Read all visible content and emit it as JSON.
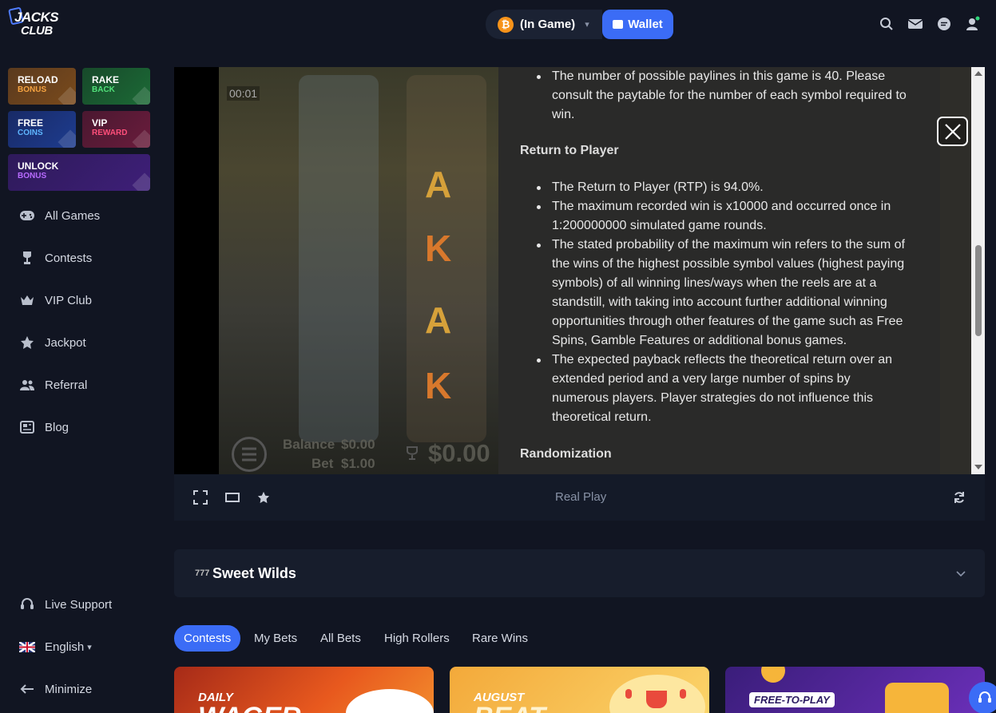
{
  "brand": {
    "line1": "JACKS",
    "line2": "CLUB"
  },
  "header": {
    "balance_label": "(In Game)",
    "currency_symbol": "₿",
    "wallet_label": "Wallet"
  },
  "promos": [
    {
      "title": "RELOAD",
      "sub": "BONUS",
      "color": "#f6a341"
    },
    {
      "title": "RAKE",
      "sub": "BACK",
      "color": "#52e27a"
    },
    {
      "title": "FREE",
      "sub": "COINS",
      "color": "#5fb6ff"
    },
    {
      "title": "VIP",
      "sub": "REWARD",
      "color": "#ff4f7a"
    },
    {
      "title": "UNLOCK",
      "sub": "BONUS",
      "color": "#b86bff"
    }
  ],
  "nav": {
    "items": [
      "All Games",
      "Contests",
      "VIP Club",
      "Jackpot",
      "Referral",
      "Blog"
    ],
    "bottom": [
      "Live Support",
      "English",
      "Minimize"
    ]
  },
  "game": {
    "timer": "00:01",
    "hud_balance_label": "Balance",
    "hud_balance_value": "$0.00",
    "hud_bet_label": "Bet",
    "hud_bet_value": "$1.00",
    "hud_win_value": "$0.00",
    "symbols": [
      "A",
      "K",
      "A",
      "K"
    ],
    "rules": {
      "b1": "The number of possible paylines in this game is 40. Please consult the paytable for the number of each symbol required to win.",
      "h1": "Return to Player",
      "b2": "The Return to Player (RTP) is 94.0%.",
      "b3": "The maximum recorded win is x10000 and occurred once in 1:200000000 simulated game rounds.",
      "b4": "The stated probability of the maximum win refers to the sum of the wins of the highest possible symbol values (highest paying symbols) of all winning lines/ways when the reels are at a standstill, with taking into account further additional winning opportunities through other features of the game such as Free Spins, Gamble Features or additional bonus games.",
      "b5": "The expected payback reflects the theoretical return over an extended period and a very large number of spins by numerous players. Player strategies do not influence this theoretical return.",
      "h2": "Randomization"
    },
    "mode_label": "Real Play"
  },
  "game_section": {
    "title": "Sweet Wilds",
    "icon_text": "777"
  },
  "tabs": [
    "Contests",
    "My Bets",
    "All Bets",
    "High Rollers",
    "Rare Wins"
  ],
  "cards": [
    {
      "label": "DAILY",
      "label2": "WAGER"
    },
    {
      "label": "AUGUST",
      "label2": "BEAT"
    },
    {
      "label": "FREE-TO-PLAY"
    }
  ]
}
